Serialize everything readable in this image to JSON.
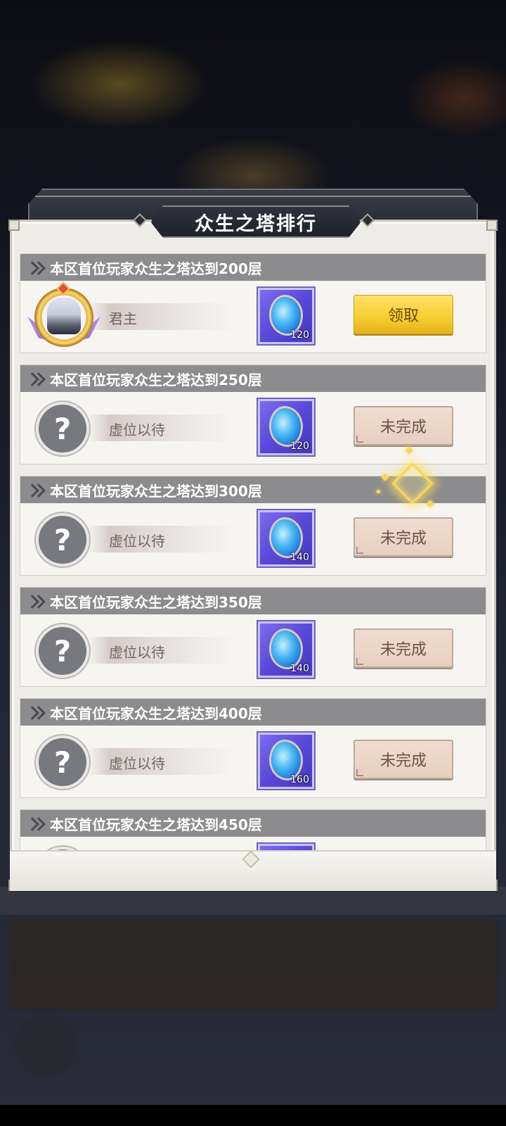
{
  "dialog": {
    "title": "众生之塔排行",
    "tasks": [
      {
        "header": "本区首位玩家众生之塔达到200层",
        "player_name": "君主",
        "reward_count": "120",
        "button_label": "领取"
      },
      {
        "header": "本区首位玩家众生之塔达到250层",
        "player_name": "虚位以待",
        "reward_count": "120",
        "button_label": "未完成"
      },
      {
        "header": "本区首位玩家众生之塔达到300层",
        "player_name": "虚位以待",
        "reward_count": "140",
        "button_label": "未完成"
      },
      {
        "header": "本区首位玩家众生之塔达到350层",
        "player_name": "虚位以待",
        "reward_count": "140",
        "button_label": "未完成"
      },
      {
        "header": "本区首位玩家众生之塔达到400层",
        "player_name": "虚位以待",
        "reward_count": "160",
        "button_label": "未完成"
      },
      {
        "header": "本区首位玩家众生之塔达到450层"
      }
    ],
    "unknown_avatar_glyph": "?"
  },
  "colors": {
    "claim_button": "#f6cd2e",
    "pending_button": "#e7cfc0",
    "header_bar": "#8c8c8e",
    "reward_tile": "#5a48d8"
  }
}
